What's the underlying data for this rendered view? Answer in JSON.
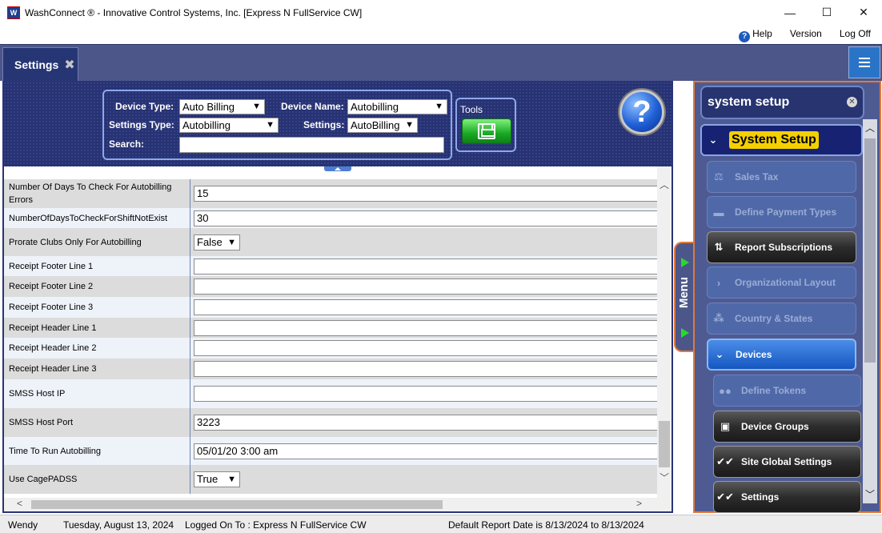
{
  "window": {
    "title": "WashConnect ® - Innovative Control Systems, Inc. [Express N FullService CW]",
    "icon_text": "W",
    "minimize": "—",
    "maximize": "☐",
    "close": "✕"
  },
  "top_links": {
    "help": "Help",
    "version": "Version",
    "logoff": "Log Off"
  },
  "tab": {
    "label": "Settings",
    "close": "✖"
  },
  "filters": {
    "device_type_label": "Device Type:",
    "device_type_value": "Auto Billing",
    "device_name_label": "Device Name:",
    "device_name_value": "Autobilling",
    "settings_type_label": "Settings Type:",
    "settings_type_value": "Autobilling",
    "settings_label": "Settings:",
    "settings_value": "AutoBilling",
    "search_label": "Search:",
    "search_value": ""
  },
  "tools": {
    "label": "Tools"
  },
  "help_glyph": "?",
  "settings_rows": [
    {
      "label": "Number Of Days To Check For Autobilling Errors",
      "type": "input",
      "value": "15"
    },
    {
      "label": "NumberOfDaysToCheckForShiftNotExist",
      "type": "input",
      "value": "30"
    },
    {
      "label": "Prorate Clubs Only For Autobilling",
      "type": "select",
      "value": "False"
    },
    {
      "label": "Receipt Footer Line 1",
      "type": "input",
      "value": ""
    },
    {
      "label": "Receipt Footer Line 2",
      "type": "input",
      "value": ""
    },
    {
      "label": "Receipt Footer Line 3",
      "type": "input",
      "value": ""
    },
    {
      "label": "Receipt Header Line 1",
      "type": "input",
      "value": ""
    },
    {
      "label": "Receipt Header Line 2",
      "type": "input",
      "value": ""
    },
    {
      "label": "Receipt Header Line 3",
      "type": "input",
      "value": ""
    },
    {
      "label": "SMSS Host IP",
      "type": "input",
      "value": ""
    },
    {
      "label": "SMSS Host Port",
      "type": "input",
      "value": "3223"
    },
    {
      "label": "Time To Run Autobilling",
      "type": "input",
      "value": "05/01/20 3:00 am"
    },
    {
      "label": "Use CagePADSS",
      "type": "select",
      "value": "True"
    }
  ],
  "menu_handle": {
    "label": "Menu"
  },
  "side_panel": {
    "title": "system setup",
    "close": "✕",
    "items": [
      {
        "label": "System Setup",
        "style": "head",
        "icon": "chevron-down-icon"
      },
      {
        "label": "Sales Tax",
        "style": "dis",
        "icon": "tax-icon"
      },
      {
        "label": "Define Payment Types",
        "style": "dis",
        "icon": "card-icon"
      },
      {
        "label": "Report Subscriptions",
        "style": "dark",
        "icon": "report-icon"
      },
      {
        "label": "Organizational Layout",
        "style": "dis",
        "icon": "chevron-right-icon"
      },
      {
        "label": "Country & States",
        "style": "dis",
        "icon": "hierarchy-icon"
      },
      {
        "label": "Devices",
        "style": "blue",
        "icon": "chevron-down-icon"
      },
      {
        "label": "Define Tokens",
        "style": "dis",
        "icon": "tokens-icon"
      },
      {
        "label": "Device Groups",
        "style": "dark",
        "icon": "device-groups-icon"
      },
      {
        "label": "Site Global Settings",
        "style": "dark",
        "icon": "checklist-icon"
      },
      {
        "label": "Settings",
        "style": "dark",
        "icon": "checklist-icon"
      }
    ]
  },
  "status": {
    "user": "Wendy",
    "date": "Tuesday, August 13, 2024",
    "logged_on": "Logged On To : Express N FullService CW",
    "report_date": "Default Report Date is 8/13/2024 to 8/13/2024"
  }
}
